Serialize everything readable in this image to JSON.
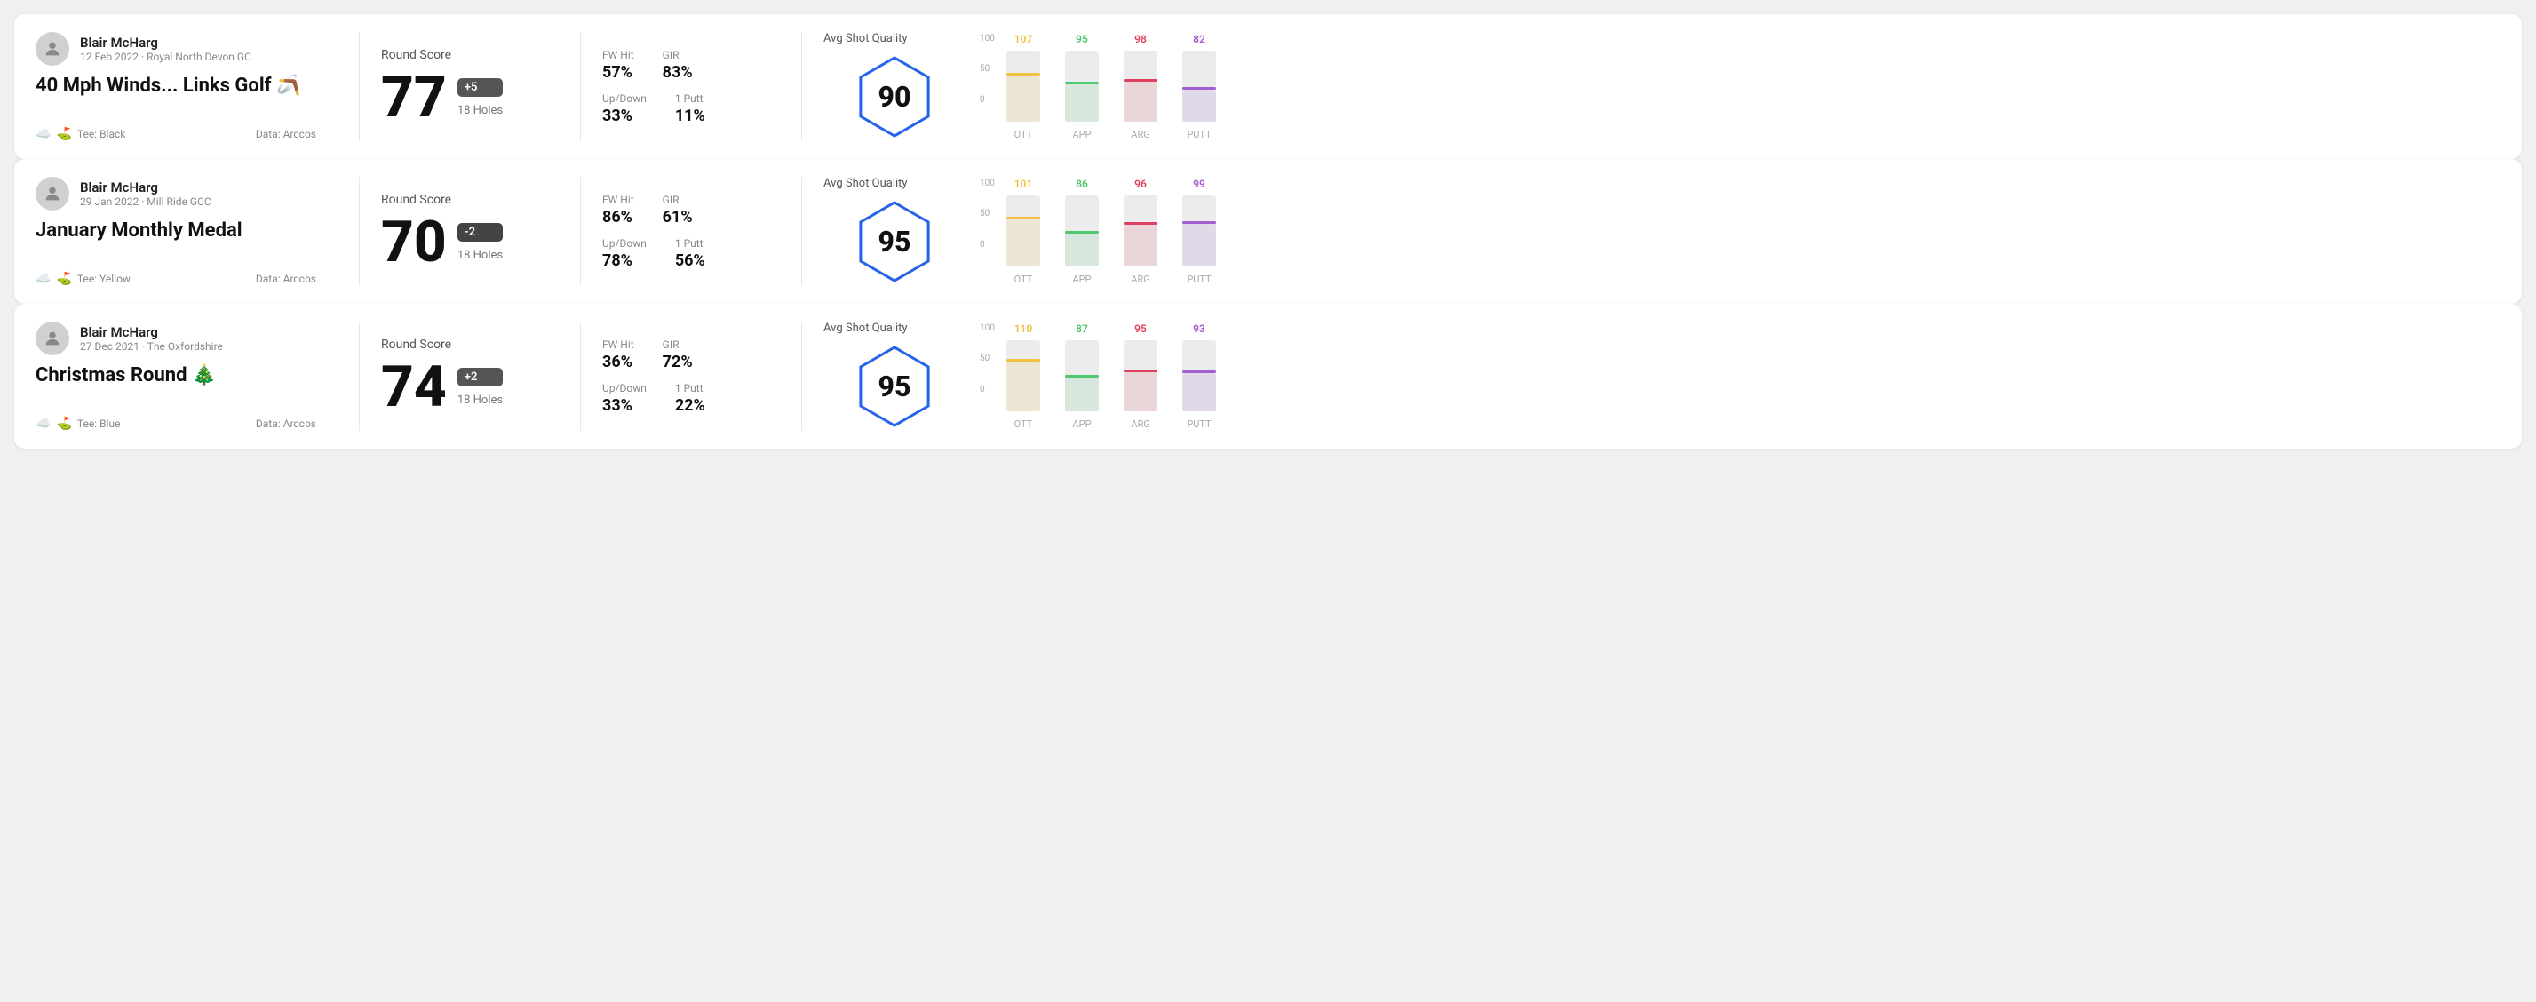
{
  "rounds": [
    {
      "id": "round-1",
      "user": {
        "name": "Blair McHarg",
        "date": "12 Feb 2022",
        "club": "Royal North Devon GC"
      },
      "title": "40 Mph Winds... Links Golf 🪃",
      "tee": "Black",
      "data_source": "Arccos",
      "score": 77,
      "score_diff": "+5",
      "holes": "18 Holes",
      "fw_hit": "57%",
      "gir": "83%",
      "up_down": "33%",
      "one_putt": "11%",
      "avg_shot_quality": 90,
      "chart": {
        "ott": {
          "value": 107,
          "color": "#f0c040",
          "fill_pct": 80
        },
        "app": {
          "value": 95,
          "color": "#50c870",
          "fill_pct": 65
        },
        "arg": {
          "value": 98,
          "color": "#e04060",
          "fill_pct": 70
        },
        "putt": {
          "value": 82,
          "color": "#a060d0",
          "fill_pct": 55
        }
      }
    },
    {
      "id": "round-2",
      "user": {
        "name": "Blair McHarg",
        "date": "29 Jan 2022",
        "club": "Mill Ride GCC"
      },
      "title": "January Monthly Medal",
      "tee": "Yellow",
      "data_source": "Arccos",
      "score": 70,
      "score_diff": "-2",
      "holes": "18 Holes",
      "fw_hit": "86%",
      "gir": "61%",
      "up_down": "78%",
      "one_putt": "56%",
      "avg_shot_quality": 95,
      "chart": {
        "ott": {
          "value": 101,
          "color": "#f0c040",
          "fill_pct": 82
        },
        "app": {
          "value": 86,
          "color": "#50c870",
          "fill_pct": 58
        },
        "arg": {
          "value": 96,
          "color": "#e04060",
          "fill_pct": 72
        },
        "putt": {
          "value": 99,
          "color": "#a060d0",
          "fill_pct": 75
        }
      }
    },
    {
      "id": "round-3",
      "user": {
        "name": "Blair McHarg",
        "date": "27 Dec 2021",
        "club": "The Oxfordshire"
      },
      "title": "Christmas Round 🎄",
      "tee": "Blue",
      "data_source": "Arccos",
      "score": 74,
      "score_diff": "+2",
      "holes": "18 Holes",
      "fw_hit": "36%",
      "gir": "72%",
      "up_down": "33%",
      "one_putt": "22%",
      "avg_shot_quality": 95,
      "chart": {
        "ott": {
          "value": 110,
          "color": "#f0c040",
          "fill_pct": 88
        },
        "app": {
          "value": 87,
          "color": "#50c870",
          "fill_pct": 59
        },
        "arg": {
          "value": 95,
          "color": "#e04060",
          "fill_pct": 68
        },
        "putt": {
          "value": 93,
          "color": "#a060d0",
          "fill_pct": 66
        }
      }
    }
  ],
  "chart_y_labels": [
    "100",
    "50",
    "0"
  ],
  "chart_x_labels": [
    "OTT",
    "APP",
    "ARG",
    "PUTT"
  ]
}
